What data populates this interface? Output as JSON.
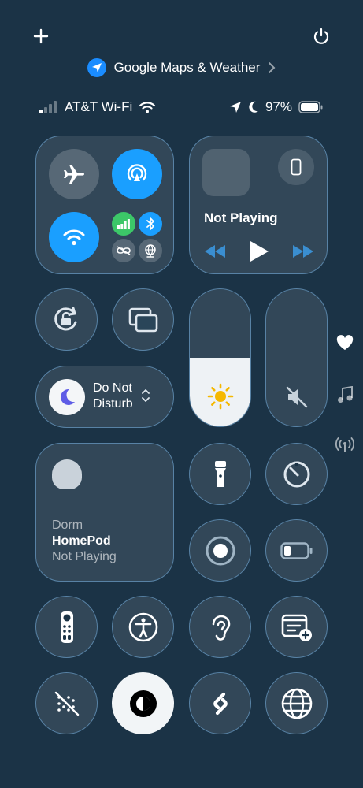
{
  "header": {
    "add_icon": "plus-icon",
    "power_icon": "power-icon"
  },
  "banner": {
    "icon": "location-arrow-icon",
    "label": "Google Maps & Weather",
    "chevron": "chevron-right-icon"
  },
  "status": {
    "carrier": "AT&T Wi-Fi",
    "battery": "97%",
    "signal_bars": 1,
    "battery_level": 0.97
  },
  "connectivity": {
    "airplane": {
      "icon": "airplane-icon",
      "on": false
    },
    "airdrop": {
      "icon": "airdrop-icon",
      "on": true
    },
    "wifi": {
      "icon": "wifi-icon",
      "on": true
    },
    "cellular": {
      "icon": "cellular-icon",
      "on": true
    },
    "bluetooth": {
      "icon": "bluetooth-icon",
      "on": true
    },
    "hotspot": {
      "icon": "personal-hotspot-icon",
      "on": false
    },
    "vpn": {
      "icon": "globe-vpn-icon",
      "on": false
    }
  },
  "media": {
    "title": "Not Playing"
  },
  "controls": {
    "brightness_level": 0.5,
    "volume_muted": true
  },
  "dnd": {
    "label": "Do Not Disturb"
  },
  "homepod": {
    "room": "Dorm",
    "name": "HomePod",
    "status": "Not Playing"
  },
  "side_rail": {
    "favorites_icon": "heart-icon",
    "music_icon": "music-note-icon",
    "connectivity_icon": "antenna-icon"
  },
  "colors": {
    "background": "#1b3346",
    "accent_blue": "#1a9fff",
    "cellular_green": "#3cc768",
    "tile_border": "#78b4e6"
  }
}
